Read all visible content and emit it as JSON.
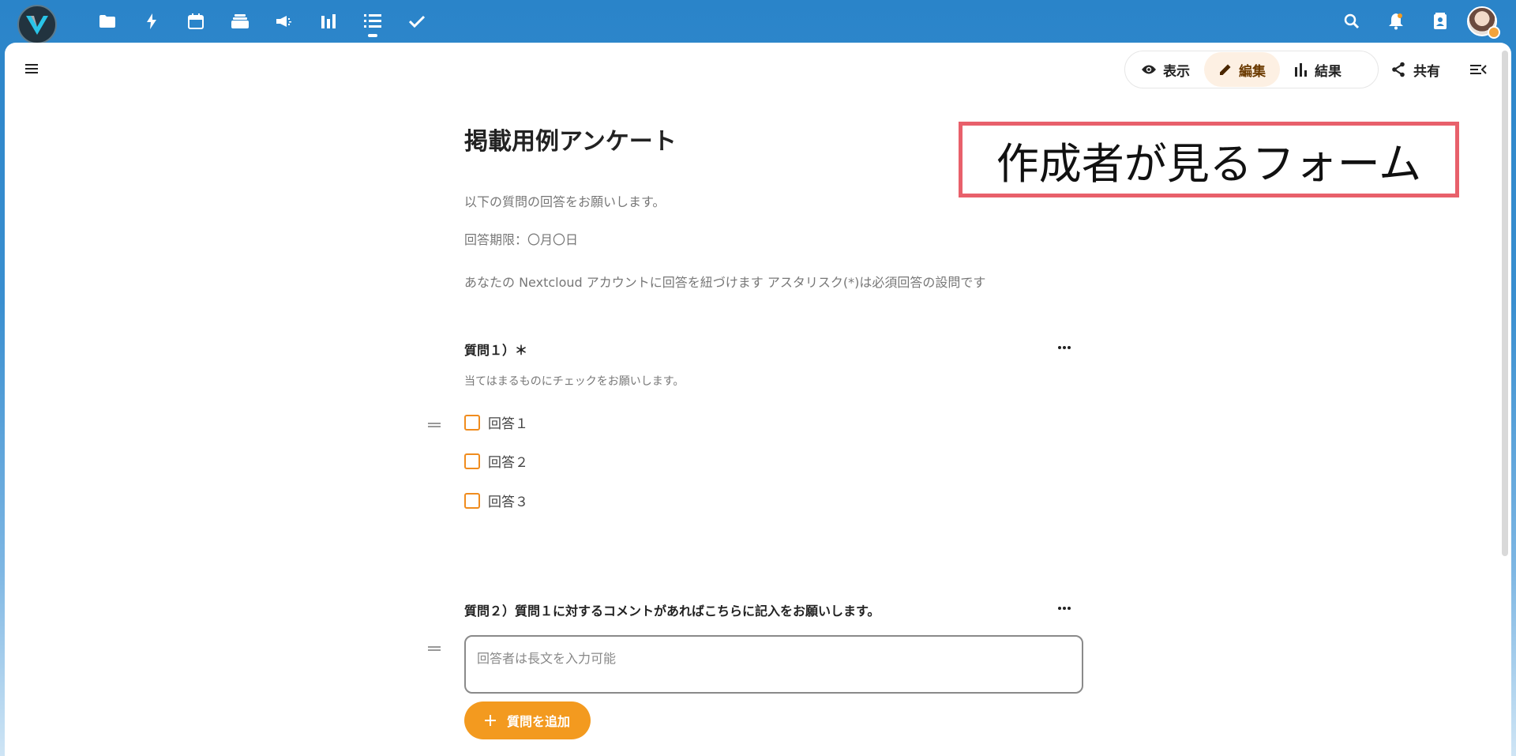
{
  "topbar": {
    "apps": [
      {
        "icon": "folder-icon",
        "label": "files"
      },
      {
        "icon": "lightning-icon",
        "label": "activity"
      },
      {
        "icon": "calendar-icon",
        "label": "calendar"
      },
      {
        "icon": "deck-icon",
        "label": "deck"
      },
      {
        "icon": "megaphone-icon",
        "label": "announcements"
      },
      {
        "icon": "bar-chart-icon",
        "label": "analytics"
      },
      {
        "icon": "list-icon",
        "label": "forms"
      },
      {
        "icon": "checkmark-icon",
        "label": "tasks"
      }
    ],
    "active_app_index": 6
  },
  "header": {
    "modes": [
      {
        "label": "表示",
        "icon": "eye-icon"
      },
      {
        "label": "編集",
        "icon": "pencil-icon"
      },
      {
        "label": "結果",
        "icon": "bar-chart-icon"
      }
    ],
    "active_mode": "編集",
    "share_label": "共有"
  },
  "form": {
    "title": "掲載用例アンケート",
    "desc1": "以下の質問の回答をお願いします。",
    "desc2": "回答期限：〇月〇日",
    "desc3": "あなたの Nextcloud アカウントに回答を紐づけます アスタリスク(*)は必須回答の設問です",
    "q1": {
      "title": "質問１）＊",
      "subtitle": "当てはまるものにチェックをお願いします。",
      "options": [
        "回答１",
        "回答２",
        "回答３"
      ]
    },
    "q2": {
      "title": "質問２）質問１に対するコメントがあればこちらに記入をお願いします。",
      "placeholder": "回答者は長文を入力可能"
    },
    "add_question_label": "質問を追加"
  },
  "annotation": "作成者が見るフォーム",
  "colors": {
    "topbar": "#2a84c9",
    "accent": "#f39a1f",
    "annotation_border": "#e8606b"
  }
}
